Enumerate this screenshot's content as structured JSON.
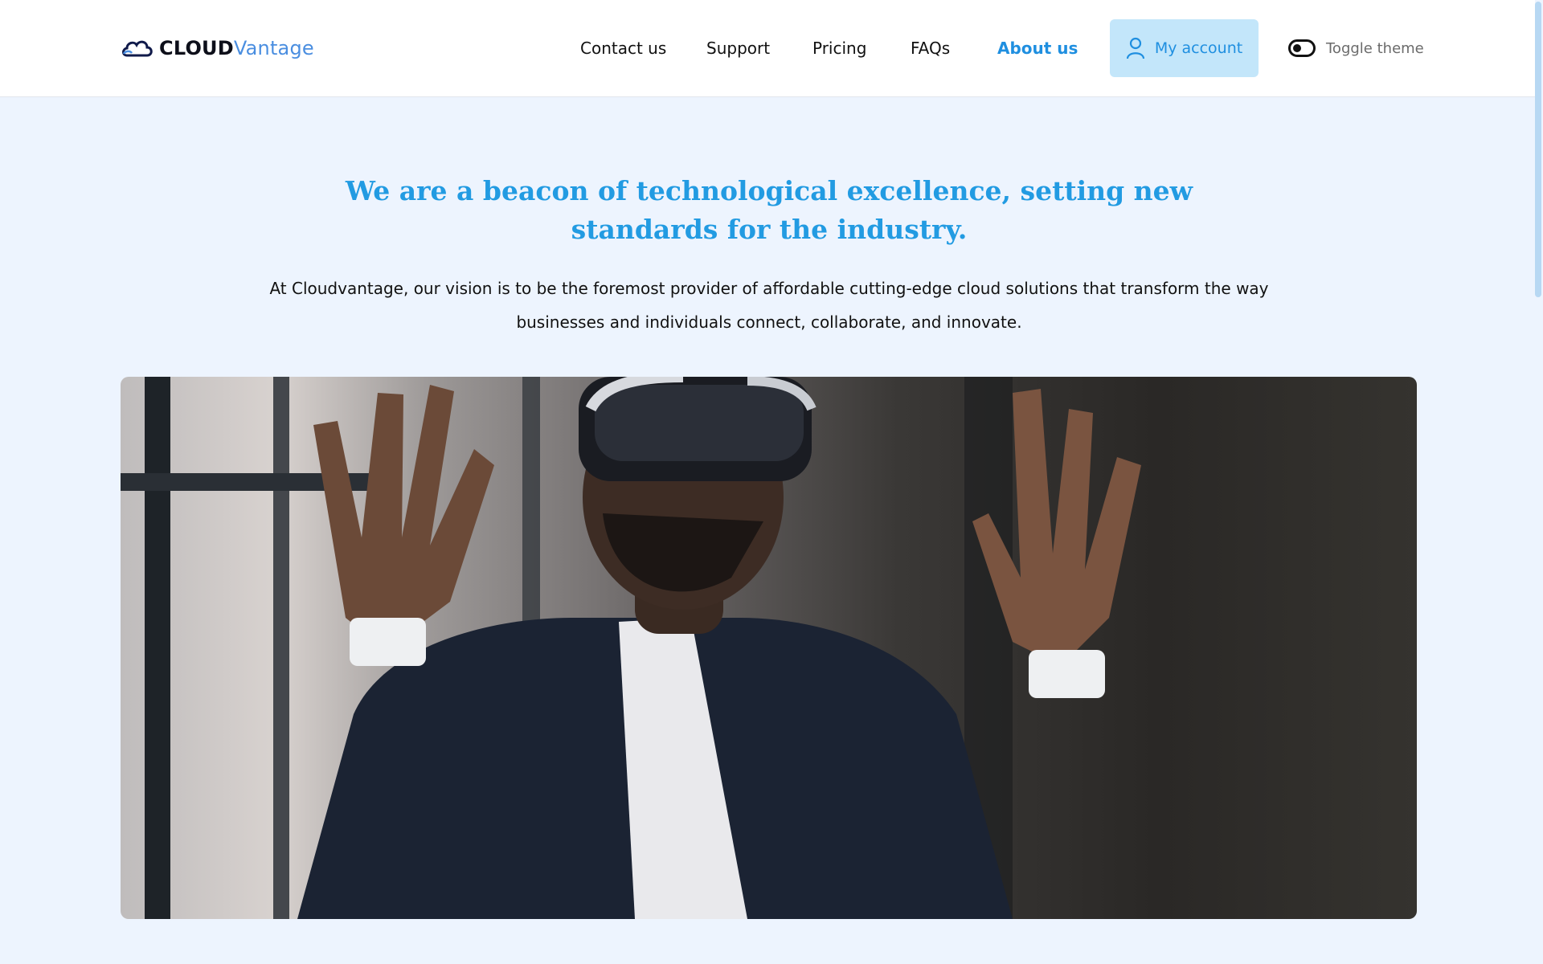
{
  "brand": {
    "name_part1": "CLOUD",
    "name_part2": "Vantage",
    "accent": "#4a8ee0"
  },
  "nav": {
    "items": [
      {
        "label": "Contact us",
        "active": false
      },
      {
        "label": "Support",
        "active": false
      },
      {
        "label": "Pricing",
        "active": false
      },
      {
        "label": "FAQs",
        "active": false
      },
      {
        "label": "About us",
        "active": true
      }
    ],
    "account_label": "My account",
    "account_icon": "user-icon",
    "toggle_label": "Toggle theme",
    "toggle_icon": "toggle-switch-icon"
  },
  "hero": {
    "headline": "We are a beacon of technological excellence, setting new standards for the industry.",
    "body": "At Cloudvantage, our vision is to be the foremost provider of affordable cutting-edge cloud solutions that transform the way businesses and individuals connect, collaborate, and innovate."
  },
  "colors": {
    "page_bg": "#edf4fe",
    "header_bg": "#ffffff",
    "link_active": "#1f8fe0",
    "headline": "#229be2",
    "account_bg": "#c3e6fa"
  }
}
